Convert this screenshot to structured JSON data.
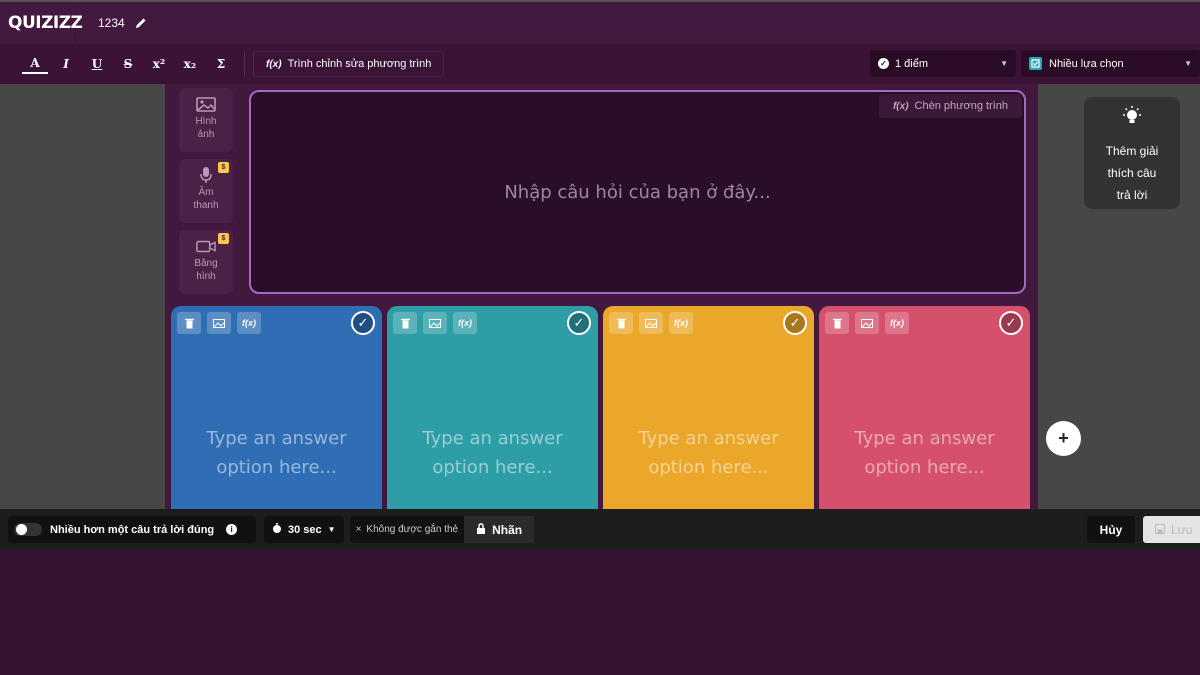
{
  "app": {
    "logo": "QUIZIZZ",
    "quiz_title": "1234"
  },
  "toolbar": {
    "format_buttons": [
      "A",
      "I",
      "U",
      "S",
      "x²",
      "x₂",
      "Σ"
    ],
    "equation_editor_label": "Trình chỉnh sửa phương trình",
    "equation_icon": "f(x)",
    "points_label": "1 điểm",
    "question_type_label": "Nhiều lựa chọn"
  },
  "media": {
    "image_label": "Hình ảnh",
    "audio_label": "Âm thanh",
    "video_label": "Băng hình",
    "badge": "$"
  },
  "question": {
    "placeholder": "Nhập câu hỏi của bạn ở đây...",
    "insert_equation_label": "Chèn phương trình"
  },
  "answers": [
    {
      "placeholder_line1": "Type an answer",
      "placeholder_line2": "option here...",
      "color": "#2f6db5"
    },
    {
      "placeholder_line1": "Type an answer",
      "placeholder_line2": "option here...",
      "color": "#2d9da6"
    },
    {
      "placeholder_line1": "Type an answer",
      "placeholder_line2": "option here...",
      "color": "#eba72a"
    },
    {
      "placeholder_line1": "Type an answer",
      "placeholder_line2": "option here...",
      "color": "#d5506b"
    }
  ],
  "card_tool_icons": [
    "trash-icon",
    "image-icon",
    "equation-icon"
  ],
  "explanation": {
    "line1": "Thêm giải",
    "line2": "thích câu",
    "line3": "trả lời"
  },
  "add_option": "+",
  "bottom": {
    "multiple_correct_label": "Nhiều hơn một câu trả lời đúng",
    "time_label": "30 sec",
    "no_tag_label": "Không được gắn thẻ",
    "tag_label": "Nhãn",
    "cancel_label": "Hủy",
    "save_label": "Lưu"
  }
}
